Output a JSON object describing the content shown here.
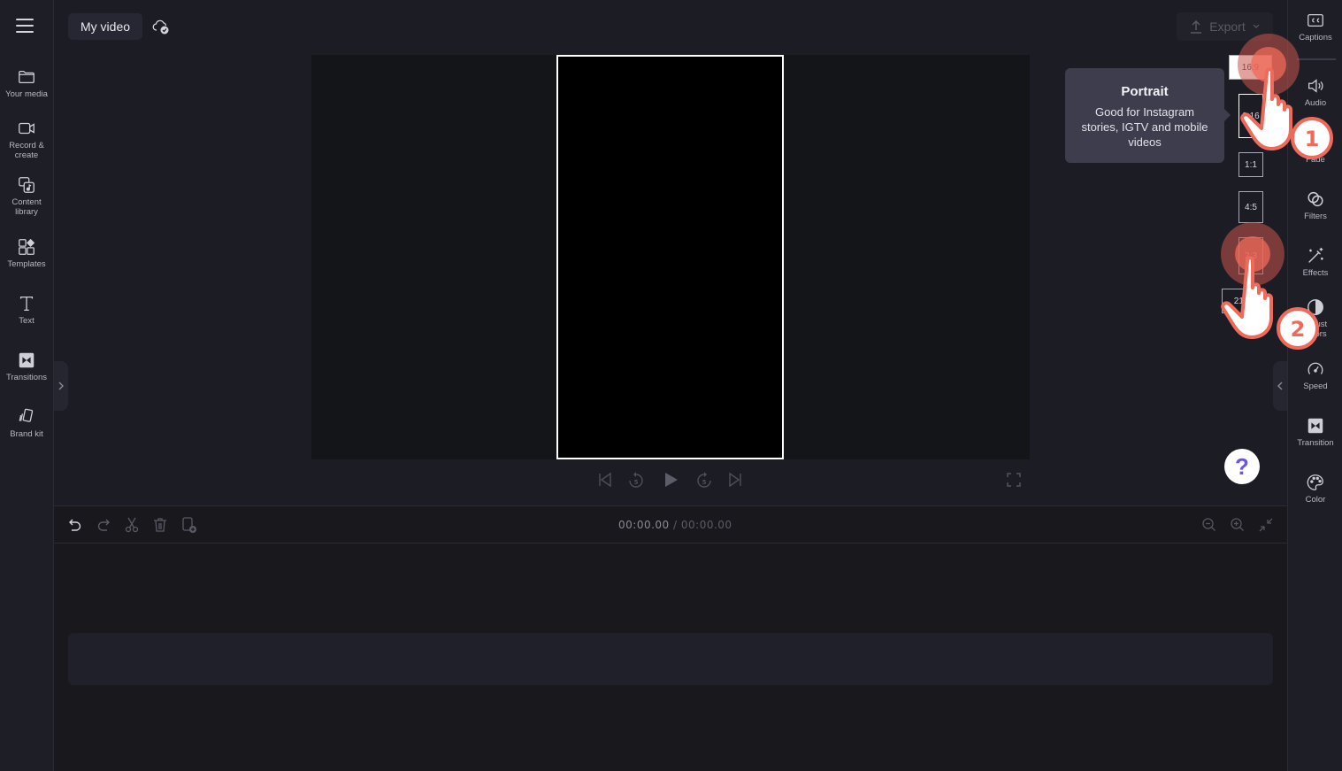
{
  "app": {
    "project_title": "My video",
    "cloud_status_icon": "cloud-check-icon"
  },
  "left_sidebar": {
    "menu_icon": "hamburger-icon",
    "items": [
      {
        "label": "Your media",
        "icon": "folder-icon"
      },
      {
        "label": "Record &\ncreate",
        "icon": "video-camera-icon"
      },
      {
        "label": "Content\nlibrary",
        "icon": "content-library-icon"
      },
      {
        "label": "Templates",
        "icon": "templates-icon"
      },
      {
        "label": "Text",
        "icon": "text-icon"
      },
      {
        "label": "Transitions",
        "icon": "transitions-icon"
      },
      {
        "label": "Brand kit",
        "icon": "brand-kit-icon"
      }
    ]
  },
  "header": {
    "export_label": "Export"
  },
  "aspect_ratios": {
    "options": [
      "16:9",
      "9:16",
      "1:1",
      "4:5",
      "2:3",
      "21:9"
    ],
    "selected": "9:16"
  },
  "tooltip": {
    "title": "Portrait",
    "body": "Good for Instagram stories, IGTV and mobile videos"
  },
  "player": {
    "current_time": "00:00.00",
    "separator": "/",
    "total_time": "00:00.00"
  },
  "right_sidebar": {
    "items": [
      {
        "label": "Captions",
        "icon": "captions-icon"
      },
      {
        "label": "Audio",
        "icon": "audio-icon"
      },
      {
        "label": "Fade",
        "icon": "fade-icon"
      },
      {
        "label": "Filters",
        "icon": "filters-icon"
      },
      {
        "label": "Effects",
        "icon": "effects-icon"
      },
      {
        "label": "Adjust colors",
        "icon": "adjust-colors-icon"
      },
      {
        "label": "Speed",
        "icon": "speed-icon"
      },
      {
        "label": "Transition",
        "icon": "transition-icon"
      },
      {
        "label": "Color",
        "icon": "color-palette-icon"
      }
    ]
  },
  "help": {
    "label": "?"
  },
  "annotations": {
    "step1": "1",
    "step2": "2"
  },
  "colors": {
    "accent_cursor": "#f06a5a",
    "help_question": "#6d55e0"
  }
}
